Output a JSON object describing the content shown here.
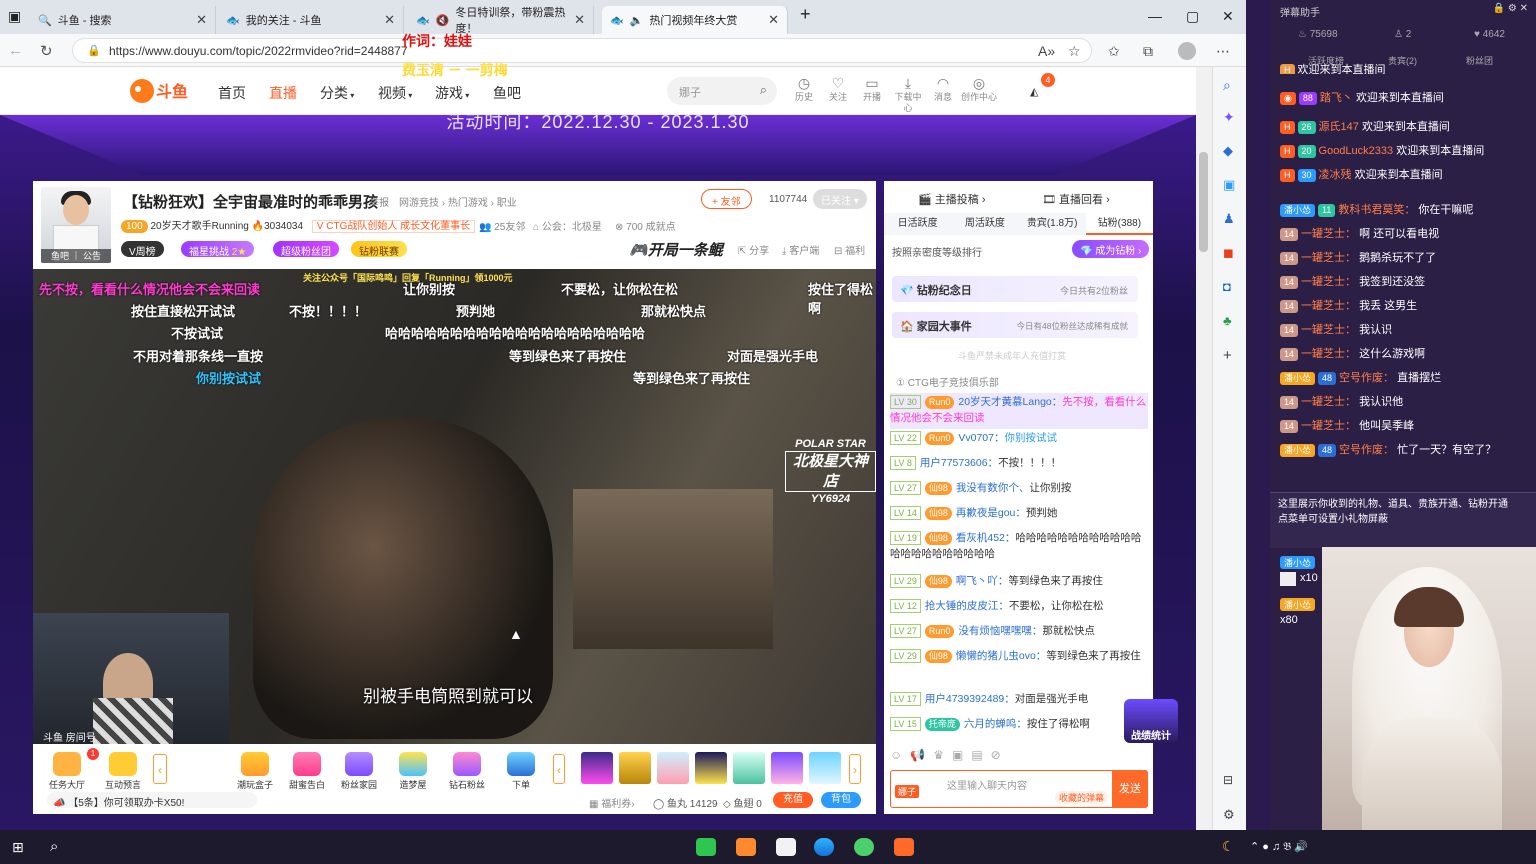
{
  "browser": {
    "tabs": [
      {
        "title": "斗鱼 - 搜索",
        "icon": "search-icon"
      },
      {
        "title": "我的关注 - 斗鱼",
        "icon": "douyu-icon"
      },
      {
        "title": "冬日特训祭，带粉震热度！",
        "icon": "douyu-icon"
      },
      {
        "title": "热门视频年终大赏",
        "icon": "douyu-icon"
      }
    ],
    "url": "https://www.douyu.com/topic/2022rmvideo?rid=2448877"
  },
  "overlay": {
    "lyric_line1": "作词：娃娃",
    "lyric_line2": "费玉清 － 一剪梅"
  },
  "site_nav": {
    "logo": "斗鱼",
    "items": [
      "首页",
      "直播",
      "分类",
      "视频",
      "游戏",
      "鱼吧"
    ],
    "search_placeholder": "娜子",
    "header_icons": [
      "历史",
      "关注",
      "开播",
      "下载中心",
      "消息",
      "创作中心"
    ],
    "notif_count": "4"
  },
  "banner": "活动时间：2022.12.30 - 2023.1.30",
  "room": {
    "title": "【钻粉狂欢】全宇宙最准时的乖乖男孩",
    "report": "举报",
    "breadcrumb": "网游竞技 › 热门游戏 › 职业",
    "streamer": "20岁天才歌手Running",
    "heat": "3034034",
    "tag": "CTG战队创始人 成长文化董事长",
    "neighbors": "25友邻",
    "guild": "公会：北极星",
    "points": "700 成就点",
    "follow": "友邻",
    "fans": "1107744",
    "followed": "已关注",
    "avatar_label": "鱼吧 ｜ 公告",
    "pills": [
      "V周榜",
      "福星挑战",
      "超级粉丝团",
      "钻粉联赛"
    ],
    "promo": "开局一条鲲",
    "actions": [
      "分享",
      "客户端",
      "福利"
    ]
  },
  "video": {
    "top_notice": "关注公众号「国际鸣鸣」回复「Running」领1000元",
    "danmaku": [
      "先不按，看看什么情况他会不会来回读",
      "让你别按",
      "不要松，让你松在松",
      "按住了得松啊",
      "按住直接松开试试",
      "不按！！！！",
      "预判她",
      "那就松快点",
      "不按试试",
      "哈哈哈哈哈哈哈哈哈哈哈哈哈哈哈哈哈哈哈哈",
      "不用对着那条线一直按",
      "等到绿色来了再按住",
      "对面是强光手电",
      "你别按试试",
      "等到绿色来了再按住"
    ],
    "subtitle": "别被手电筒照到就可以",
    "watermark": [
      "POLAR STAR",
      "北极星大神店",
      "YY6924"
    ],
    "cam_label": "斗鱼 房间号"
  },
  "gifts": {
    "left": [
      "任务大厅",
      "互动预言"
    ],
    "items": [
      "潮玩盒子",
      "甜蜜告白",
      "粉丝家园",
      "造梦屋",
      "钻石粉丝",
      "下单"
    ],
    "footer_notice": "【5条】你可领取办卡X50!",
    "welfare": "福利券",
    "yuwan": "鱼丸 14129",
    "yuchi": "鱼翅 0",
    "recharge": "充值",
    "bag": "背包"
  },
  "chat": {
    "tabs_top": [
      "主播投稿",
      "直播回看"
    ],
    "rank_tabs": [
      "日活跃度",
      "周活跃度",
      "贵宾(1.8万)",
      "钻粉(388)"
    ],
    "rank_hint": "按照亲密度等级排行",
    "become_vip": "成为钻粉",
    "event1": "钻粉纪念日",
    "event1_info": "今日共有2位粉丝",
    "event2": "家园大事件",
    "event2_info": "今日有48位粉丝达成稀有成就",
    "notice": "斗鱼严禁未成年人充值打赏",
    "first_rank": "CTG电子竞技俱乐部",
    "messages": [
      {
        "lv": "LV 30",
        "fan": "Run0",
        "name": "20岁天才黄慕Lango：",
        "text": "先不按，看看什么情况他会不会来回读"
      },
      {
        "lv": "LV 22",
        "fan": "Run0",
        "name": "Vv0707：",
        "text": "你别按试试"
      },
      {
        "lv": "LV 8",
        "fan": "",
        "name": "用户77573606：",
        "text": "不按！！！！"
      },
      {
        "lv": "LV 27",
        "fan": "仙98",
        "name": "我没有数你个、",
        "text": "让你别按"
      },
      {
        "lv": "LV 14",
        "fan": "仙98",
        "name": "再歉夜是gou：",
        "text": "预判她"
      },
      {
        "lv": "LV 19",
        "fan": "仙98",
        "name": "看灰机452：",
        "text": "哈哈哈哈哈哈哈哈哈哈哈哈哈哈哈哈哈哈哈哈哈哈"
      },
      {
        "lv": "LV 29",
        "fan": "仙98",
        "name": "啊飞丶吖：",
        "text": "等到绿色来了再按住"
      },
      {
        "lv": "LV 12",
        "fan": "",
        "name": "抢大锤的皮皮江：",
        "text": "不要松，让你松在松"
      },
      {
        "lv": "LV 27",
        "fan": "Run0",
        "name": "没有烦恼嘿嘿嘿：",
        "text": "那就松快点"
      },
      {
        "lv": "LV 29",
        "fan": "仙98",
        "name": "懒懒的猪儿虫ovo：",
        "text": "等到绿色来了再按住"
      },
      {
        "lv": "LV 17",
        "fan": "",
        "name": "用户4739392489：",
        "text": "对面是强光手电"
      },
      {
        "lv": "LV 15",
        "fan": "托帝庞",
        "name": "六月的蝉鸣：",
        "text": "按住了得松啊"
      }
    ],
    "input_placeholder": "这里输入聊天内容",
    "barrage_btn": "收藏的弹幕",
    "send": "发送",
    "battle": "战绩统计"
  },
  "assistant": {
    "title": "弹幕助手",
    "stats": [
      "75698",
      "2",
      "4642"
    ],
    "tabs": [
      "活跃度榜",
      "贵宾(2)",
      "粉丝团"
    ],
    "lines": [
      {
        "badge": "",
        "name": "",
        "text": "欢迎来到本直播间"
      },
      {
        "badge": "88",
        "name": "踏飞丶",
        "text": "欢迎来到本直播间"
      },
      {
        "badge": "26",
        "name": "源氏147",
        "text": "欢迎来到本直播间"
      },
      {
        "badge": "20",
        "name": "GoodLuck2333",
        "text": "欢迎来到本直播间"
      },
      {
        "badge": "30",
        "name": "凌冰残",
        "text": "欢迎来到本直播间"
      },
      {
        "badge": "11",
        "name": "教科书君莫笑：",
        "text": "你在干嘛呢"
      },
      {
        "badge": "14",
        "name": "一罐芝士：",
        "text": "啊 还可以看电视"
      },
      {
        "badge": "14",
        "name": "一罐芝士：",
        "text": "鹅鹅杀玩不了了"
      },
      {
        "badge": "14",
        "name": "一罐芝士：",
        "text": "我签到还没签"
      },
      {
        "badge": "14",
        "name": "一罐芝士：",
        "text": "我丢 这男生"
      },
      {
        "badge": "14",
        "name": "一罐芝士：",
        "text": "我认识"
      },
      {
        "badge": "14",
        "name": "一罐芝士：",
        "text": "这什么游戏啊"
      },
      {
        "badge": "48",
        "name": "空号作废：",
        "text": "直播摆烂"
      },
      {
        "badge": "14",
        "name": "一罐芝士：",
        "text": "我认识他"
      },
      {
        "badge": "14",
        "name": "一罐芝士：",
        "text": "他叫吴季峰"
      },
      {
        "badge": "48",
        "name": "空号作废：",
        "text": "忙了一天？有空了？"
      }
    ],
    "gift_hint": "这里展示你收到的礼物、道具、贵族开通、钻粉开通\n点菜单可设置小礼物屏蔽",
    "gift_x10": "x10",
    "gift_x80": "x80"
  }
}
